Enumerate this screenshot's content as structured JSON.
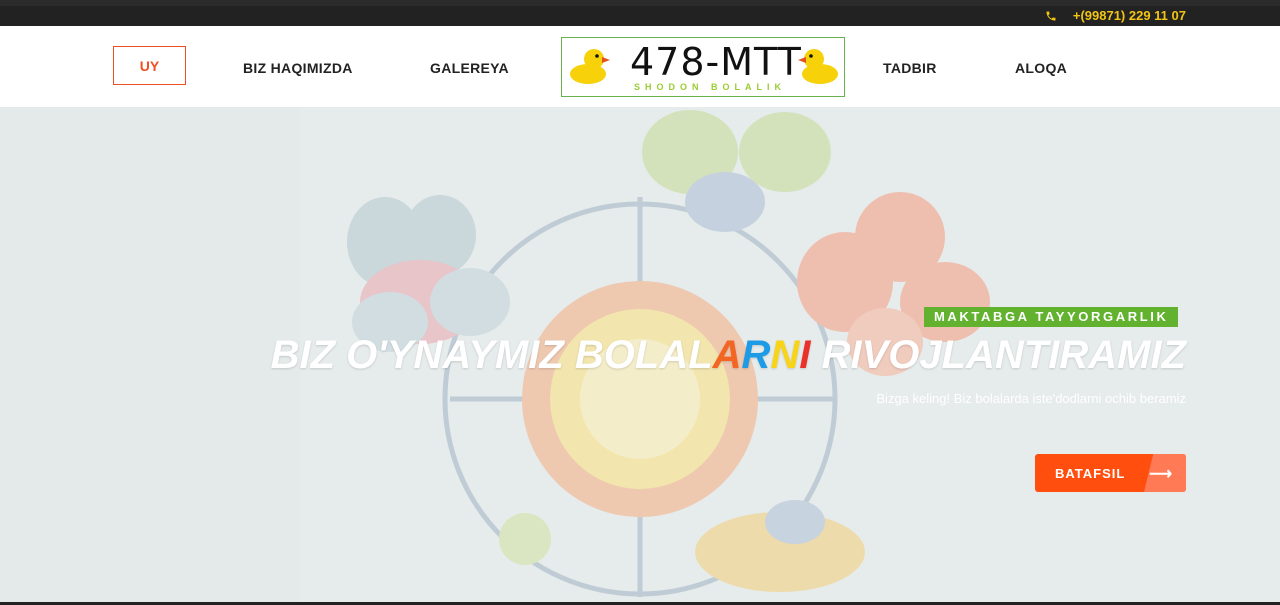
{
  "topbar": {
    "phone": "+(99871) 229 11 07",
    "phone_icon": "phone-icon",
    "accent": "#f2c413"
  },
  "nav": {
    "items": [
      "UY",
      "BIZ HAQIMIZDA",
      "GALEREYA",
      "TADBIR",
      "ALOQA"
    ],
    "active_color": "#f04e23"
  },
  "logo": {
    "title": "478-MTT",
    "subtitle": "SHODON BOLALIK"
  },
  "hero": {
    "badge": "MAKTABGA TAYYORGARLIK",
    "headline_pre": "BIZ O'YNAYMIZ BOLAL",
    "headline_a": "A",
    "headline_r": "R",
    "headline_n": "N",
    "headline_i": "I",
    "headline_post": " RIVOJLANTIRAMIZ",
    "subtitle": "Bizga keling! Biz bolalarda iste'dodlarni ochib beramiz",
    "button_label": "BATAFSIL",
    "button_icon": "arrow-right-icon",
    "badge_color": "#62b22f",
    "button_color": "#ff4e0e"
  }
}
